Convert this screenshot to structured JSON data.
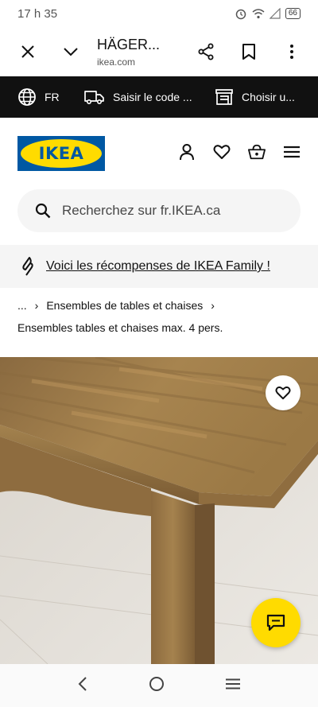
{
  "status": {
    "time": "17 h 35",
    "battery": "66"
  },
  "browser": {
    "title": "HÄGER...",
    "url": "ikea.com"
  },
  "topbar": {
    "language": "FR",
    "postal": "Saisir le code ...",
    "store": "Choisir u..."
  },
  "logo": {
    "text": "IKEA"
  },
  "search": {
    "placeholder": "Recherchez sur fr.IKEA.ca"
  },
  "family": {
    "text": "Voici les récompenses de IKEA Family !"
  },
  "breadcrumb": {
    "ellipsis": "...",
    "category": "Ensembles de tables et chaises"
  },
  "subcategory": "Ensembles tables et chaises max. 4 pers.",
  "colors": {
    "brand_blue": "#0058a3",
    "brand_yellow": "#ffdb00",
    "topbar_bg": "#111111"
  }
}
